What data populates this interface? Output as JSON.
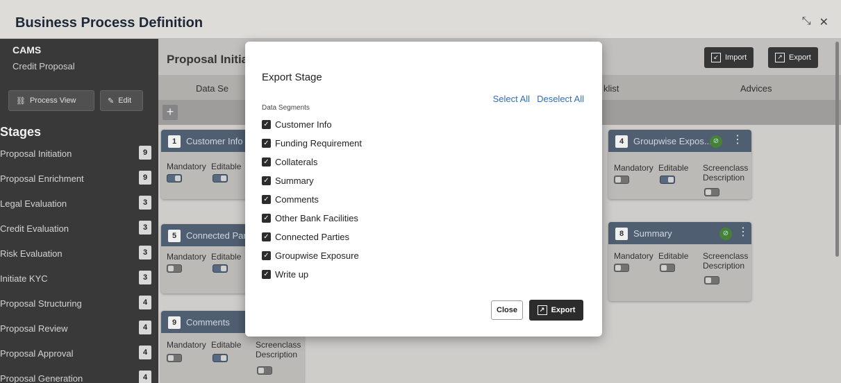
{
  "window": {
    "title": "Business Process Definition",
    "icons": [
      "collapse-icon",
      "close-icon"
    ]
  },
  "sidebar": {
    "app": "CAMS",
    "subtitle": "Credit Proposal",
    "process_view_label": "Process View",
    "edit_label": "Edit",
    "stages_heading": "Stages",
    "stages": [
      {
        "label": "Proposal Initiation",
        "count": "9"
      },
      {
        "label": "Proposal Enrichment",
        "count": "9"
      },
      {
        "label": "Legal Evaluation",
        "count": "3"
      },
      {
        "label": "Credit Evaluation",
        "count": "3"
      },
      {
        "label": "Risk Evaluation",
        "count": "3"
      },
      {
        "label": "Initiate KYC",
        "count": "3"
      },
      {
        "label": "Proposal Structuring",
        "count": "4"
      },
      {
        "label": "Proposal Review",
        "count": "4"
      },
      {
        "label": "Proposal Approval",
        "count": "4"
      },
      {
        "label": "Proposal Generation",
        "count": "4"
      }
    ]
  },
  "main": {
    "title": "Proposal Initiati",
    "import_label": "Import",
    "export_label": "Export",
    "tabs": [
      {
        "label": "Data Se"
      },
      {
        "label": "klist"
      },
      {
        "label": "Advices"
      }
    ],
    "add_label": "+",
    "cards": [
      {
        "num": "1",
        "title": "Customer Info"
      },
      {
        "num": "4",
        "title": "Groupwise Expos..."
      },
      {
        "num": "5",
        "title": "Connected Par"
      },
      {
        "num": "8",
        "title": "Summary"
      },
      {
        "num": "9",
        "title": "Comments"
      }
    ],
    "mandatory_label": "Mandatory",
    "editable_label": "Editable",
    "screenclass_label": "Screenclass",
    "description_label": "Description"
  },
  "modal": {
    "title": "Export Stage",
    "segments_heading": "Data Segments",
    "select_all": "Select All",
    "deselect_all": "Deselect All",
    "items": [
      "Customer Info",
      "Funding Requirement",
      "Collaterals",
      "Summary",
      "Comments",
      "Other Bank Facilities",
      "Connected Parties",
      "Groupwise Exposure",
      "Write up"
    ],
    "close_label": "Close",
    "export_label": "Export"
  },
  "colors": {
    "sidebar": "#3d3d3d",
    "card_header": "#546478",
    "check_green": "#4c8a3c",
    "link_blue": "#2f6fb5"
  }
}
